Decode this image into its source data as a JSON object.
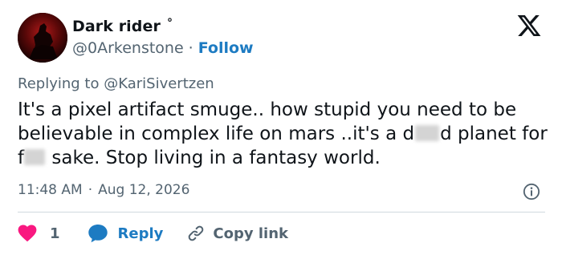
{
  "author": {
    "display_name": "Dark rider",
    "badge": "°",
    "handle": "@0Arkenstone",
    "separator": "·",
    "follow_label": "Follow"
  },
  "reply": {
    "prefix": "Replying to",
    "mention": "@KariSivertzen"
  },
  "tweet": {
    "part1": "It's a pixel artifact smuge.. how stupid you need to be believable in complex life on mars ..it's a d",
    "part2": "d planet for f",
    "part3": " sake. Stop living in a fantasy world."
  },
  "meta": {
    "time": "11:48 AM",
    "separator": "·",
    "date": "Aug 12, 2026"
  },
  "actions": {
    "like_count": "1",
    "reply_label": "Reply",
    "copy_label": "Copy link"
  },
  "colors": {
    "text": "#0f1419",
    "muted": "#536471",
    "link": "#1d7bc2",
    "heart": "#f91880",
    "divider": "#cfd9de"
  },
  "icons": [
    "x-logo-icon",
    "info-icon",
    "heart-icon",
    "reply-bubble-icon",
    "link-icon"
  ]
}
